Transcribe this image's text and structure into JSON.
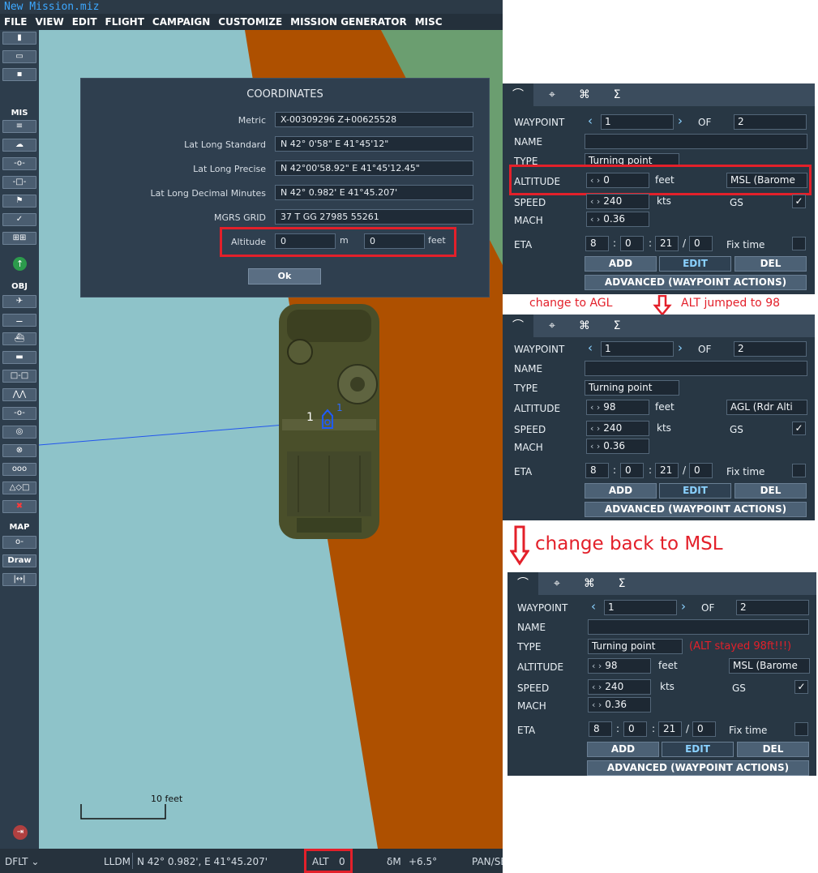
{
  "app": {
    "title": "New Mission.miz"
  },
  "menu": [
    "FILE",
    "VIEW",
    "EDIT",
    "FLIGHT",
    "CAMPAIGN",
    "CUSTOMIZE",
    "MISSION GENERATOR",
    "MISC"
  ],
  "toolbar": {
    "sec_mis": "MIS",
    "sec_obj": "OBJ",
    "sec_map": "MAP",
    "draw": "Draw"
  },
  "map": {
    "scale_label": "10 feet",
    "wp_num": "1",
    "wp_num2": "1"
  },
  "coords": {
    "title": "COORDINATES",
    "rows": [
      {
        "label": "Metric",
        "value": "X-00309296 Z+00625528"
      },
      {
        "label": "Lat Long Standard",
        "value": "N 42° 0'58\"   E 41°45'12\""
      },
      {
        "label": "Lat Long Precise",
        "value": "N 42°00'58.92\"   E 41°45'12.45\""
      },
      {
        "label": "Lat Long Decimal Minutes",
        "value": "N 42° 0.982'   E 41°45.207'"
      },
      {
        "label": "MGRS GRID",
        "value": "37 T GG 27985 55261"
      }
    ],
    "alt_label": "Altitude",
    "alt_m": "0",
    "unit_m": "m",
    "alt_ft": "0",
    "unit_ft": "feet",
    "ok": "Ok"
  },
  "status": {
    "dflt": "DFLT ⌄",
    "lldm": "LLDM",
    "coord": "N 42° 0.982', E 41°45.207'",
    "alt_label": "ALT",
    "alt_val": "0",
    "dm": "δM",
    "dm_val": "+6.5°",
    "pan": "PAN/SE"
  },
  "wp_labels": {
    "waypoint": "WAYPOINT",
    "of": "OF",
    "name": "NAME",
    "type": "TYPE",
    "altitude": "ALTITUDE",
    "speed": "SPEED",
    "mach": "MACH",
    "eta": "ETA",
    "feet": "feet",
    "kts": "kts",
    "gs": "GS",
    "fixtime": "Fix time",
    "add": "ADD",
    "edit": "EDIT",
    "del": "DEL",
    "advanced": "ADVANCED (WAYPOINT ACTIONS)"
  },
  "panels": [
    {
      "wp": "1",
      "of": "2",
      "type": "Turning point",
      "alt": "0",
      "altref": "MSL (Barome",
      "speed": "240",
      "mach": "0.36",
      "eta_h": "8",
      "eta_m": "0",
      "eta_s": "21",
      "eta_d": "0"
    },
    {
      "wp": "1",
      "of": "2",
      "type": "Turning point",
      "alt": "98",
      "altref": "AGL (Rdr Alti",
      "speed": "240",
      "mach": "0.36",
      "eta_h": "8",
      "eta_m": "0",
      "eta_s": "21",
      "eta_d": "0"
    },
    {
      "wp": "1",
      "of": "2",
      "type": "Turning point",
      "alt": "98",
      "altref": "MSL (Barome",
      "speed": "240",
      "mach": "0.36",
      "eta_h": "8",
      "eta_m": "0",
      "eta_s": "21",
      "eta_d": "0"
    }
  ],
  "annotations": {
    "agl": "change to AGL",
    "jumped": "ALT jumped to 98",
    "back": "change back to MSL",
    "stayed": "(ALT stayed 98ft!!!)"
  },
  "colors": {
    "accent_red": "#e3202a",
    "panel": "#283744",
    "map_water": "#8ec3c9",
    "map_road": "#ae5000",
    "map_green": "#6b9e70"
  }
}
